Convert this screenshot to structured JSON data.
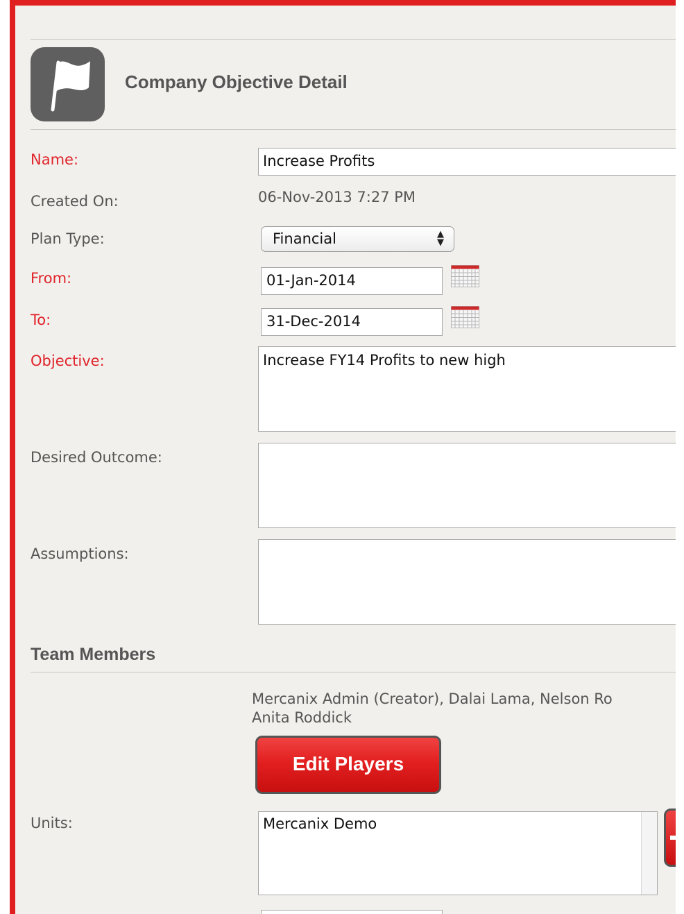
{
  "header": {
    "title": "Company Objective Detail",
    "icon": "flag-icon"
  },
  "form": {
    "name": {
      "label": "Name:",
      "value": "Increase Profits"
    },
    "created_on": {
      "label": "Created On:",
      "value": "06-Nov-2013 7:27 PM"
    },
    "plan_type": {
      "label": "Plan Type:",
      "value": "Financial"
    },
    "from": {
      "label": "From:",
      "value": "01-Jan-2014"
    },
    "to": {
      "label": "To:",
      "value": "31-Dec-2014"
    },
    "objective": {
      "label": "Objective:",
      "value": "Increase FY14 Profits to new high"
    },
    "desired_outcome": {
      "label": "Desired Outcome:",
      "value": ""
    },
    "assumptions": {
      "label": "Assumptions:",
      "value": ""
    }
  },
  "team": {
    "title": "Team Members",
    "members_line1": "Mercanix Admin (Creator), Dalai Lama, Nelson Ro",
    "members_line2": "Anita Roddick",
    "edit_button_label": "Edit Players"
  },
  "units": {
    "label": "Units:",
    "items": [
      "Mercanix Demo"
    ]
  },
  "colors": {
    "required_label": "#e0232b",
    "label": "#555555",
    "panel_bg": "#f2f0ec",
    "button_red": "#e32020",
    "frame_red": "#e02020"
  }
}
